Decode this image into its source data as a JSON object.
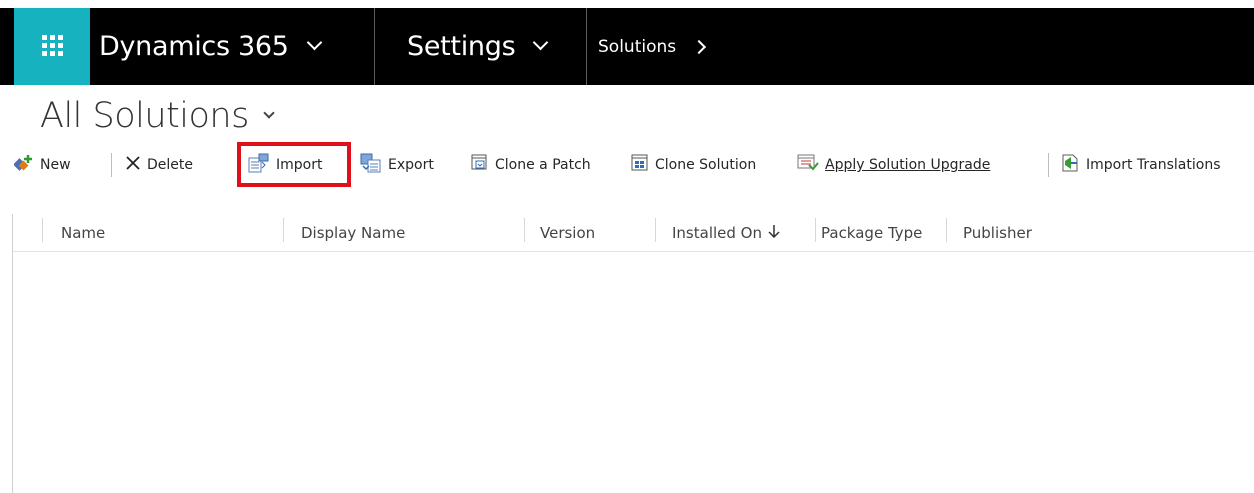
{
  "nav": {
    "app_title": "Dynamics 365",
    "area_title": "Settings",
    "breadcrumb": "Solutions"
  },
  "view": {
    "title": "All Solutions"
  },
  "toolbar": {
    "new_label": "New",
    "delete_label": "Delete",
    "import_label": "Import",
    "export_label": "Export",
    "clone_patch_label": "Clone a Patch",
    "clone_solution_label": "Clone Solution",
    "apply_upgrade_label": "Apply Solution Upgrade",
    "import_translations_label": "Import Translations"
  },
  "grid": {
    "columns": [
      {
        "label": "Name"
      },
      {
        "label": "Display Name"
      },
      {
        "label": "Version"
      },
      {
        "label": "Installed On"
      },
      {
        "label": "Package Type"
      },
      {
        "label": "Publisher"
      }
    ],
    "rows": []
  },
  "colors": {
    "waffle": "#17b2c0",
    "nav_bg": "#000000",
    "highlight": "#e0101b"
  }
}
